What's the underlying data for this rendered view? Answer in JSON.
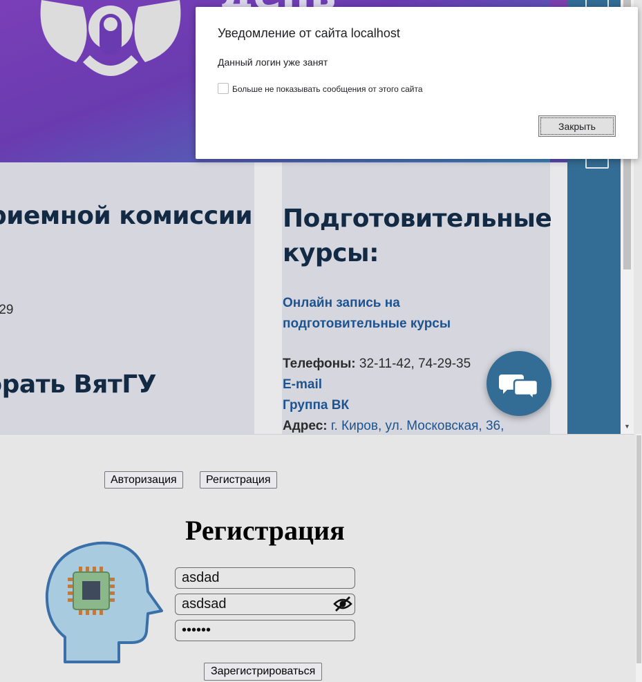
{
  "embedded": {
    "left_heading_1": "риемной комиссии",
    "left_phone_fragment": "-29",
    "left_heading_2": "брать ВятГУ",
    "mid_heading": "Подготовительные курсы:",
    "courses_link": "Онлайн запись на подготовительные курсы",
    "phones_label": "Телефоны:",
    "phones_value": "32-11-42, 74-29-35",
    "email_link": "E-mail",
    "vk_link": "Группа ВК",
    "address_label": "Адрес:",
    "address_value": "г. Киров, ул. Московская, 36,",
    "banner_text_fragment": "день",
    "colors": {
      "banner_purple": "#7a3fb8",
      "heading_navy": "#132a45",
      "link_blue": "#1c5390",
      "sidebar_blue": "#336c94"
    },
    "icons": [
      "hamburger-menu-icon",
      "square-icon",
      "chat-bubbles-icon"
    ]
  },
  "dialog": {
    "title": "Уведомление от сайта localhost",
    "message": "Данный логин уже занят",
    "checkbox_label": "Больше не показывать сообщения от этого сайта",
    "checkbox_checked": false,
    "close_label": "Закрыть"
  },
  "auth": {
    "tab_login": "Авторизация",
    "tab_register": "Регистрация",
    "title": "Регистрация",
    "login_value": "asdad",
    "password_value": "asdsad",
    "confirm_value": "••••••",
    "submit_label": "Зарегистрироваться",
    "icons": [
      "head-chip-icon",
      "eye-slash-icon"
    ]
  }
}
